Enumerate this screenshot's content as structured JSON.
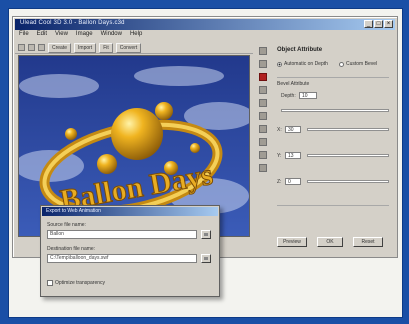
{
  "window": {
    "title": "Ulead Cool 3D 3.0 - Ballon Days.c3d",
    "controls": [
      "_",
      "□",
      "×"
    ]
  },
  "menu": [
    "File",
    "Edit",
    "View",
    "Image",
    "Window",
    "Help"
  ],
  "toolbar": {
    "buttons": [
      "Create",
      "Import",
      "Fit",
      "Convert"
    ]
  },
  "canvas": {
    "text_object": "Ballon Days",
    "colors": {
      "sky": "#2d4aa0",
      "gold": "#e0a418",
      "cloud": "#c8d4f0"
    }
  },
  "properties": {
    "title": "Object Attribute",
    "options": [
      {
        "label": "Automatic on Depth",
        "selected": true
      },
      {
        "label": "Custom Bevel",
        "selected": false
      }
    ],
    "section": "Bevel Attribute",
    "depth_label": "Depth:",
    "depth_value": "10",
    "sliders": [
      {
        "label": "X:",
        "value": "30"
      },
      {
        "label": "Y:",
        "value": "13"
      },
      {
        "label": "Z:",
        "value": "0"
      }
    ],
    "buttons": [
      "Preview",
      "OK",
      "Reset"
    ]
  },
  "dialog": {
    "title": "Export to Web Animation",
    "source_label": "Source file name:",
    "source_value": "Ballon",
    "dest_label": "Destination file name:",
    "dest_value": "C:\\Temp\\balloon_days.swf",
    "option_label": "Optimize transparency",
    "option_checked": false
  }
}
